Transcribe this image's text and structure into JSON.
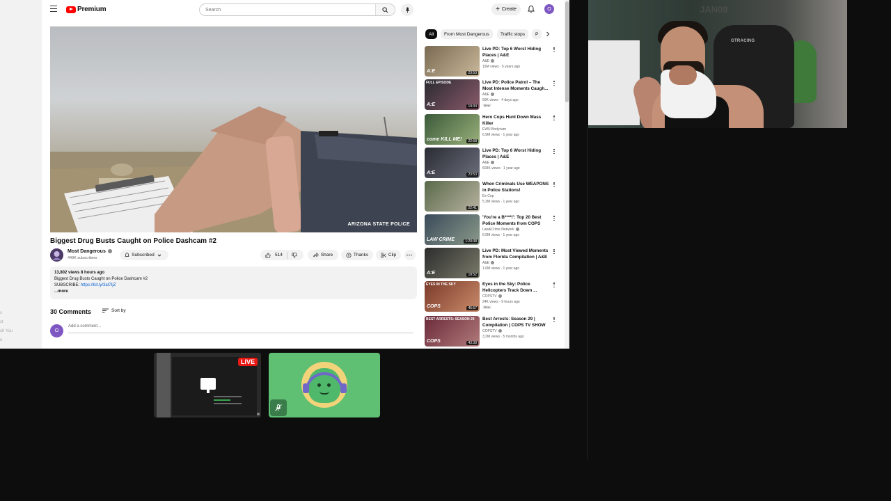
{
  "youtube": {
    "logo_text": "Premium",
    "search_placeholder": "Search",
    "create_label": "Create",
    "avatar_initial": "O",
    "video": {
      "watermark": "ARIZONA STATE POLICE",
      "title": "Biggest Drug Busts Caught on Police Dashcam #2",
      "channel": "Most Dangerous",
      "subscribers": "449K subscribers",
      "subscribed_label": "Subscribed",
      "likes": "514",
      "share_label": "Share",
      "thanks_label": "Thanks",
      "clip_label": "Clip"
    },
    "description": {
      "meta": "13,802 views  8 hours ago",
      "line1": "Biggest Drug Busts Caught on Police Dashcam #2",
      "subscribe_prefix": "SUBSCRIBE: ",
      "link": "https://bit.ly/3at7IjZ",
      "more": "...more"
    },
    "comments": {
      "count_label": "30 Comments",
      "sort_label": "Sort by",
      "placeholder": "Add a comment...",
      "avatar_initial": "O"
    },
    "chips": [
      "All",
      "From Most Dangerous",
      "Traffic stops",
      "P"
    ],
    "left_ghost": [
      "s",
      "st",
      "ch You",
      "e"
    ],
    "recommendations": [
      {
        "title": "Live PD: Top 6 Worst Hiding Places | A&E",
        "channel": "A&E",
        "verified": true,
        "meta": "19M views · 5 years ago",
        "duration": "23:53",
        "thumb_text": "A:E",
        "thumb_top": "",
        "badge": "",
        "colors": [
          "#7a6a52",
          "#c9b89a"
        ]
      },
      {
        "title": "Live PD: Police Patrol – The Most Intense Moments Caugh...",
        "channel": "A&E",
        "verified": true,
        "meta": "50K views · 4 days ago",
        "duration": "19:34",
        "thumb_text": "A:E",
        "thumb_top": "FULL EPISODE",
        "badge": "New",
        "colors": [
          "#2a2a30",
          "#8a5a6a"
        ]
      },
      {
        "title": "Hero Cops Hunt Down Mass Killer",
        "channel": "EWU Bodycam",
        "verified": false,
        "meta": "6.9M views · 1 year ago",
        "duration": "22:58",
        "thumb_text": "come KILL ME!",
        "thumb_top": "",
        "badge": "",
        "colors": [
          "#3a5a3a",
          "#9ab07a"
        ]
      },
      {
        "title": "Live PD: Top 6 Worst Hiding Places | A&E",
        "channel": "A&E",
        "verified": true,
        "meta": "609K views · 1 year ago",
        "duration": "23:53",
        "thumb_text": "A:E",
        "thumb_top": "",
        "badge": "",
        "colors": [
          "#2a2c34",
          "#6a6e7a"
        ]
      },
      {
        "title": "When Criminals Use WEAPONS in Police Stations!",
        "channel": "Ex Cop",
        "verified": false,
        "meta": "5.3M views · 1 year ago",
        "duration": "22:41",
        "thumb_text": "",
        "thumb_top": "",
        "badge": "",
        "colors": [
          "#5a6a4a",
          "#b7b2a0"
        ]
      },
      {
        "title": "'You're a B****!': Top 20 Best Police Moments from COPS",
        "channel": "Law&Crime Network",
        "verified": true,
        "meta": "6.9M views · 1 year ago",
        "duration": "1:20:38",
        "thumb_text": "LAW CRIME",
        "thumb_top": "",
        "badge": "",
        "colors": [
          "#3a4a5a",
          "#8a9a8a"
        ]
      },
      {
        "title": "Live PD: Most Viewed Moments from Florida Compilation | A&E",
        "channel": "A&E",
        "verified": true,
        "meta": "1.6M views · 1 year ago",
        "duration": "18:52",
        "thumb_text": "A:E",
        "thumb_top": "",
        "badge": "",
        "colors": [
          "#2c2c2c",
          "#7a7a6a"
        ]
      },
      {
        "title": "Eyes in the Sky: Police Helicopters Track Down ...",
        "channel": "COPSTV",
        "verified": true,
        "meta": "24K views · 9 hours ago",
        "duration": "45:57",
        "thumb_text": "COPS",
        "thumb_top": "EYES IN THE SKY",
        "badge": "New",
        "colors": [
          "#7a3a2a",
          "#c98a6a"
        ]
      },
      {
        "title": "Best Arrests: Season 29 | Compilation | COPS TV SHOW",
        "channel": "COPSTV",
        "verified": true,
        "meta": "3.2M views · 5 months ago",
        "duration": "43:38",
        "thumb_text": "COPS",
        "thumb_top": "BEST ARRESTS: SEASON 29",
        "badge": "",
        "colors": [
          "#6a2a3a",
          "#b07a7a"
        ]
      }
    ]
  },
  "webcam": {
    "wall_sign": "JAN09",
    "chair_brand": "GTRACING"
  },
  "tiles": {
    "live_label": "LIVE"
  }
}
